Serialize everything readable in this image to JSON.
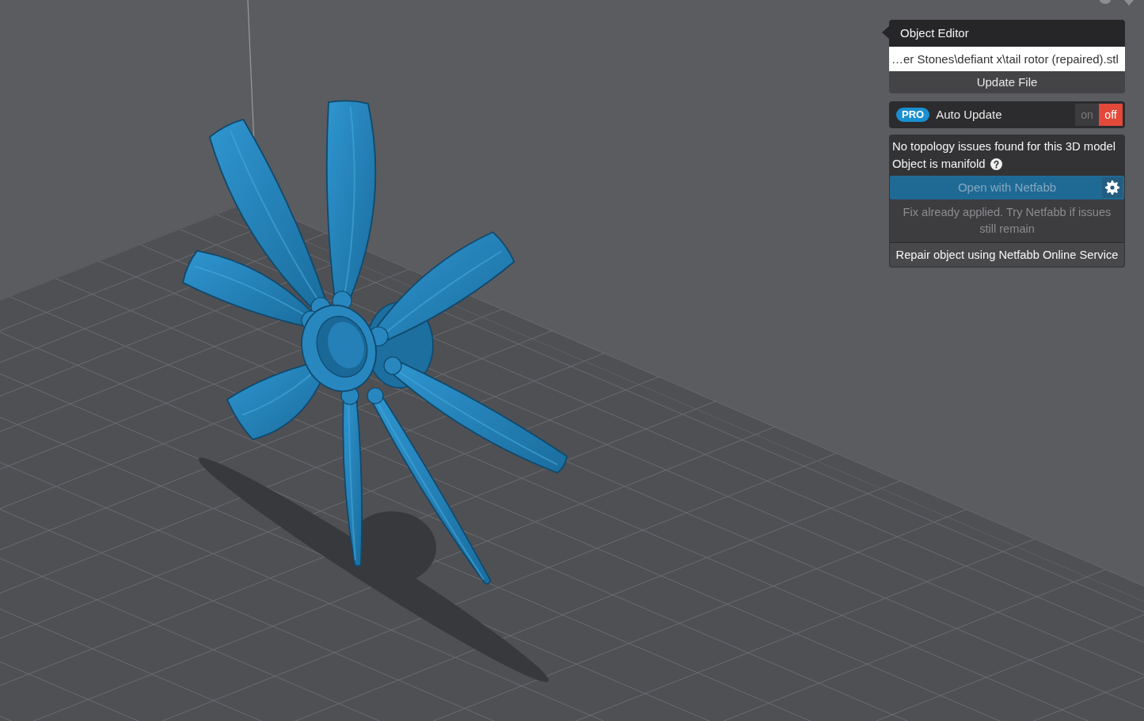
{
  "object_editor": {
    "title": "Object Editor",
    "file_path": {
      "value": "…er Stones\\defiant x\\tail rotor (repaired).stl"
    },
    "update_button": "Update File",
    "auto_update": {
      "badge": "PRO",
      "label": "Auto Update",
      "options": [
        {
          "label": "on",
          "selected": false
        },
        {
          "label": "off",
          "selected": true
        }
      ]
    },
    "topology": {
      "message": "No topology issues found for this 3D model",
      "manifold_label": "Object is manifold",
      "netfabb_button": {
        "label": "Open with Netfabb",
        "disabled": true
      },
      "note": "Fix already applied. Try Netfabb if issues still remain",
      "repair_button": "Repair object using Netfabb Online Service"
    }
  }
}
